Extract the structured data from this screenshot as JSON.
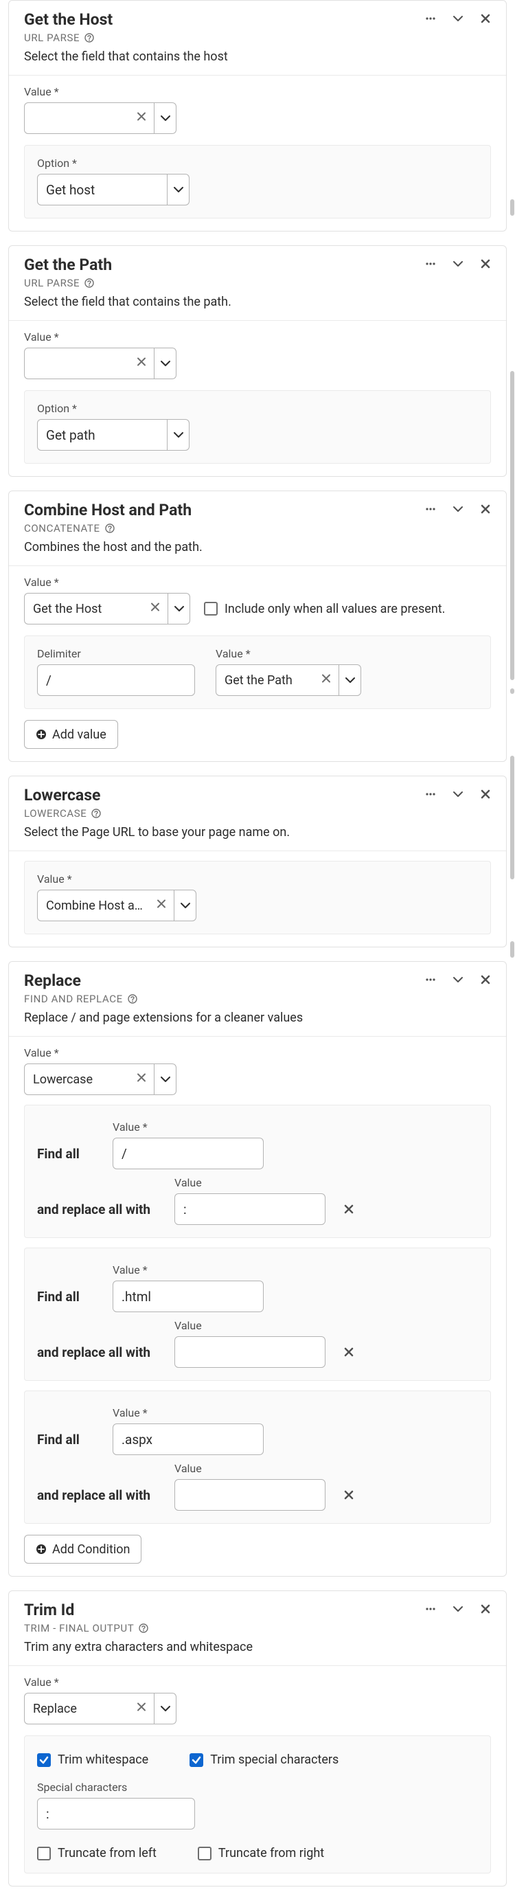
{
  "labels": {
    "value": "Value",
    "option": "Option",
    "delimiter": "Delimiter",
    "find_all": "Find all",
    "replace_all_with": "and replace all with",
    "special_characters": "Special characters"
  },
  "buttons": {
    "add_value": "Add value",
    "add_condition": "Add Condition"
  },
  "checkboxes": {
    "include_only_all": "Include only when all values are present.",
    "trim_whitespace": "Trim whitespace",
    "trim_special": "Trim special characters",
    "truncate_left": "Truncate from left",
    "truncate_right": "Truncate from right"
  },
  "cards": {
    "host": {
      "title": "Get the Host",
      "subtitle": "URL PARSE",
      "desc": "Select the field that contains the host",
      "value": "",
      "option": "Get host"
    },
    "path": {
      "title": "Get the Path",
      "subtitle": "URL PARSE",
      "desc": "Select the field that contains the path.",
      "value": "",
      "option": "Get path"
    },
    "combine": {
      "title": "Combine Host and Path",
      "subtitle": "CONCATENATE",
      "desc": "Combines the host and the path.",
      "value": "Get the Host",
      "delimiter": "/",
      "value2": "Get the Path"
    },
    "lowercase": {
      "title": "Lowercase",
      "subtitle": "LOWERCASE",
      "desc": "Select the Page URL to base your page name on.",
      "value": "Combine Host and Path"
    },
    "replace": {
      "title": "Replace",
      "subtitle": "FIND AND REPLACE",
      "desc": "Replace / and page extensions for a cleaner values",
      "value": "Lowercase",
      "rows": [
        {
          "find": "/",
          "replace": ":"
        },
        {
          "find": ".html",
          "replace": ""
        },
        {
          "find": ".aspx",
          "replace": ""
        }
      ]
    },
    "trim": {
      "title": "Trim Id",
      "subtitle": "TRIM - FINAL OUTPUT",
      "desc": "Trim any extra characters and whitespace",
      "value": "Replace",
      "special": ":"
    }
  }
}
